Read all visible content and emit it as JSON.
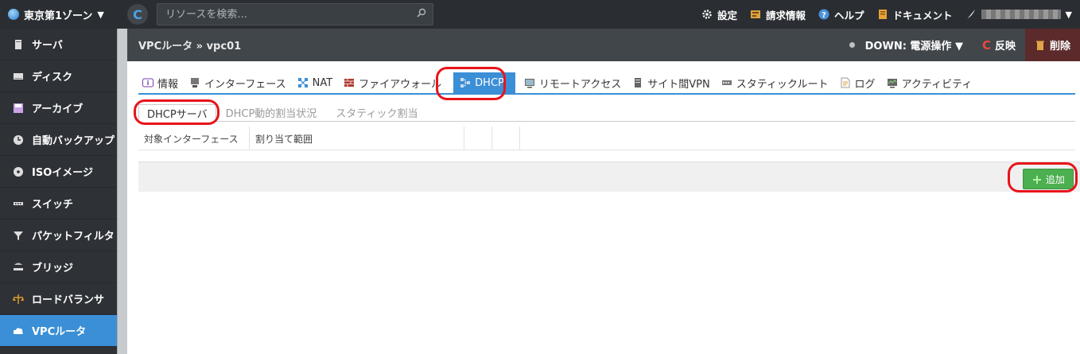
{
  "topbar": {
    "zone_label": "東京第1ゾーン",
    "search_placeholder": "リソースを検索...",
    "menu": {
      "settings": "設定",
      "billing": "請求情報",
      "help": "ヘルプ",
      "docs": "ドキュメント"
    }
  },
  "sidebar": {
    "items": [
      {
        "label": "サーバ",
        "icon": "server-icon"
      },
      {
        "label": "ディスク",
        "icon": "disk-icon"
      },
      {
        "label": "アーカイブ",
        "icon": "archive-icon"
      },
      {
        "label": "自動バックアップ",
        "icon": "clock-icon"
      },
      {
        "label": "ISOイメージ",
        "icon": "cd-icon"
      },
      {
        "label": "スイッチ",
        "icon": "switch-icon"
      },
      {
        "label": "パケットフィルタ",
        "icon": "filter-icon"
      },
      {
        "label": "ブリッジ",
        "icon": "bridge-icon"
      },
      {
        "label": "ロードバランサ",
        "icon": "balance-icon"
      },
      {
        "label": "VPCルータ",
        "icon": "cloud-icon"
      }
    ]
  },
  "header": {
    "breadcrumb": "VPCルータ » vpc01",
    "status": "DOWN: 電源操作 ▼",
    "reflect": "反映",
    "delete": "削除"
  },
  "tabs": [
    {
      "label": "情報",
      "icon": "info-icon"
    },
    {
      "label": "インターフェース",
      "icon": "interface-icon"
    },
    {
      "label": "NAT",
      "icon": "nat-icon"
    },
    {
      "label": "ファイアウォール",
      "icon": "firewall-icon"
    },
    {
      "label": "DHCP",
      "icon": "dhcp-icon"
    },
    {
      "label": "リモートアクセス",
      "icon": "remote-icon"
    },
    {
      "label": "サイト間VPN",
      "icon": "vpn-icon"
    },
    {
      "label": "スタティックルート",
      "icon": "route-icon"
    },
    {
      "label": "ログ",
      "icon": "log-icon"
    },
    {
      "label": "アクティビティ",
      "icon": "activity-icon"
    }
  ],
  "subtabs": [
    "DHCPサーバ",
    "DHCP動的割当状況",
    "スタティック割当"
  ],
  "table": {
    "columns": [
      "対象インターフェース",
      "割り当て範囲",
      "",
      ""
    ]
  },
  "footer": {
    "add_label": "追加"
  },
  "colors": {
    "accent": "#3b8fd6",
    "highlight_ring": "#e8141a",
    "add_button": "#4caf50"
  }
}
